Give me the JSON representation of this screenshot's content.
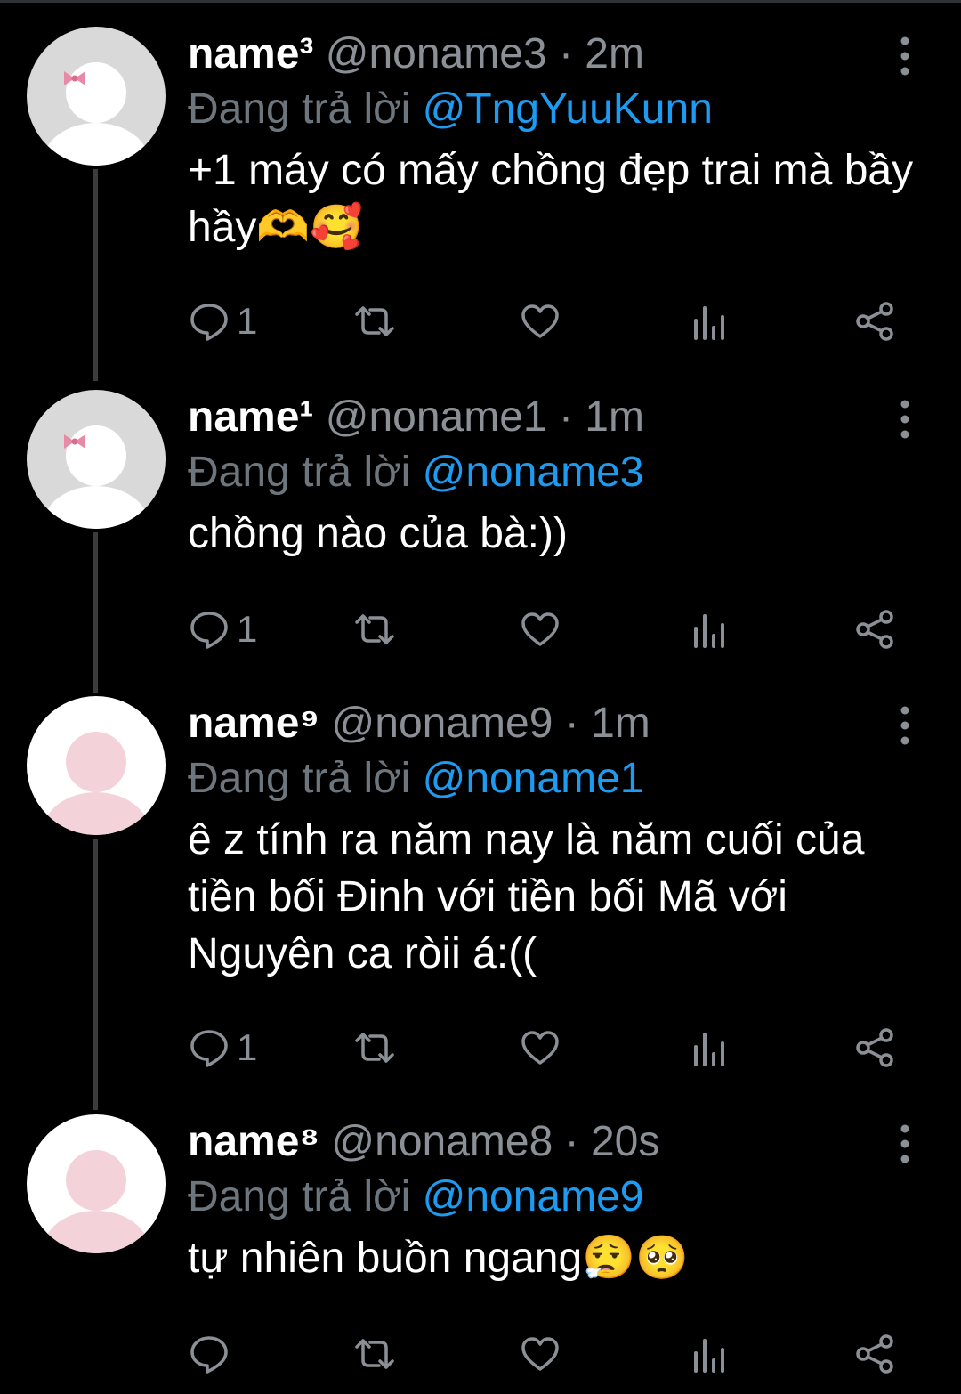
{
  "colors": {
    "background": "#000000",
    "muted": "#6e767d",
    "mention": "#1d9bf0",
    "thread_line": "#3a3d40"
  },
  "tweets": [
    {
      "display_name": "name³",
      "handle": "@noname3",
      "separator": "·",
      "time": "2m",
      "reply_prefix": "Đang trả lời",
      "reply_to": "@TngYuuKunn",
      "text": "+1 máy có mấy chồng đẹp trai mà bầy hầy🫶🥰",
      "reply_count": "1",
      "avatar_style": "grey-bow"
    },
    {
      "display_name": "name¹",
      "handle": "@noname1",
      "separator": "·",
      "time": "1m",
      "reply_prefix": "Đang trả lời",
      "reply_to": "@noname3",
      "text": "chồng nào của bà:))",
      "reply_count": "1",
      "avatar_style": "grey-bow"
    },
    {
      "display_name": "name⁹",
      "handle": "@noname9",
      "separator": "·",
      "time": "1m",
      "reply_prefix": "Đang trả lời",
      "reply_to": "@noname1",
      "text": "ê z tính ra năm nay là năm cuối của tiền bối Đinh với tiền bối Mã với Nguyên ca ròii á:((",
      "reply_count": "1",
      "avatar_style": "white-pink"
    },
    {
      "display_name": "name⁸",
      "handle": "@noname8",
      "separator": "·",
      "time": "20s",
      "reply_prefix": "Đang trả lời",
      "reply_to": "@noname9",
      "text": "tự nhiên buồn ngang😮‍💨🥺",
      "reply_count": "",
      "avatar_style": "white-pink"
    }
  ],
  "icons": [
    "reply-icon",
    "retweet-icon",
    "like-icon",
    "views-icon",
    "share-icon",
    "more-icon"
  ]
}
